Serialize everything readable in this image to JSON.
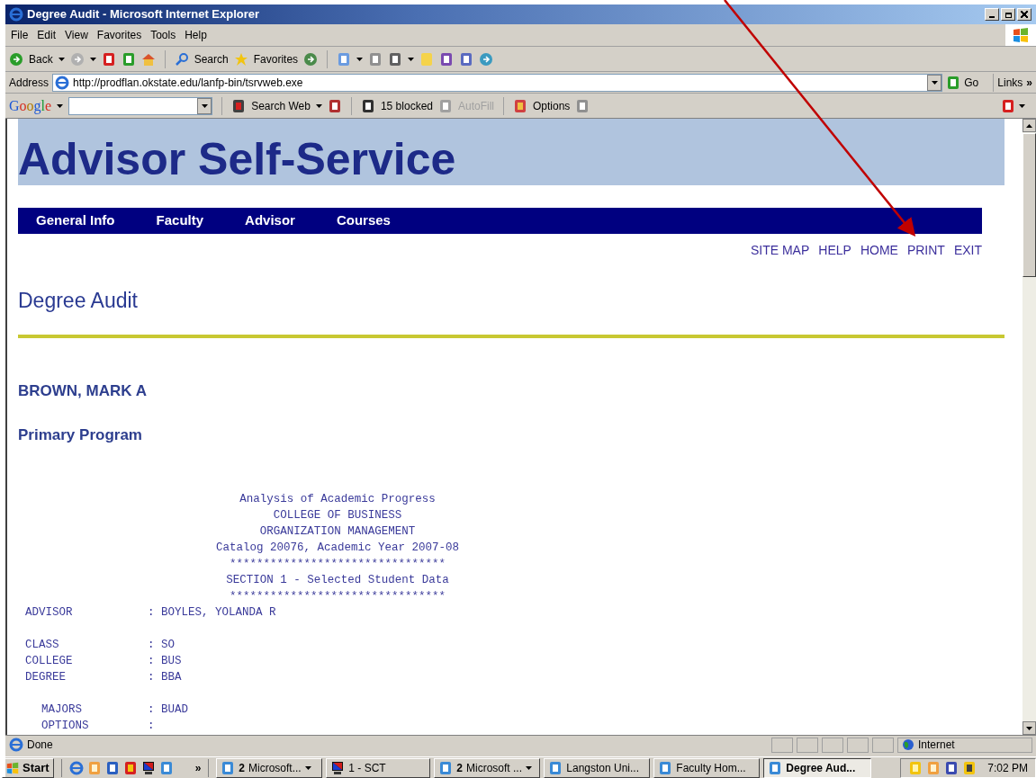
{
  "window": {
    "title": "Degree Audit - Microsoft Internet Explorer"
  },
  "menu": [
    "File",
    "Edit",
    "View",
    "Favorites",
    "Tools",
    "Help"
  ],
  "toolbar": {
    "back": "Back",
    "search": "Search",
    "favorites": "Favorites"
  },
  "address_bar": {
    "label": "Address",
    "value": "http://prodflan.okstate.edu/lanfp-bin/tsrvweb.exe",
    "go": "Go",
    "links": "Links",
    "more": "»"
  },
  "google_bar": {
    "logo": "Google",
    "search_web": "Search Web",
    "blocked": "15 blocked",
    "autofill": {
      "label": "AutoFill",
      "disabled": true
    },
    "options": "Options"
  },
  "page": {
    "banner": "Advisor Self-Service",
    "nav": [
      "General Info",
      "Faculty",
      "Advisor",
      "Courses"
    ],
    "links": [
      "SITE MAP",
      "HELP",
      "HOME",
      "PRINT",
      "EXIT"
    ],
    "heading": "Degree Audit",
    "student": "BROWN, MARK A",
    "program": "Primary Program",
    "report_header": [
      "Analysis of Academic Progress",
      "COLLEGE OF BUSINESS",
      "ORGANIZATION MANAGEMENT",
      "Catalog 20076, Academic Year 2007-08",
      "********************************",
      "SECTION 1 - Selected Student Data",
      "********************************"
    ],
    "field_groups": [
      [
        {
          "label": "ADVISOR",
          "value": ": BOYLES, YOLANDA R",
          "indent": false
        }
      ],
      [
        {
          "label": "CLASS",
          "value": ": SO",
          "indent": false
        },
        {
          "label": "COLLEGE",
          "value": ": BUS",
          "indent": false
        },
        {
          "label": "DEGREE",
          "value": ": BBA",
          "indent": false
        }
      ],
      [
        {
          "label": "MAJORS",
          "value": ": BUAD",
          "indent": true
        },
        {
          "label": "OPTIONS",
          "value": ":",
          "indent": true
        }
      ]
    ]
  },
  "status_bar": {
    "text": "Done",
    "zone": "Internet"
  },
  "taskbar": {
    "start": "Start",
    "more": "»",
    "tasks": [
      {
        "count": "2",
        "label": "Microsoft...",
        "dropdown": true,
        "selected": false
      },
      {
        "label": "1 - SCT",
        "dropdown": false,
        "selected": false
      },
      {
        "count": "2",
        "label": "Microsoft ...",
        "dropdown": true,
        "selected": false
      },
      {
        "label": "Langston Uni...",
        "dropdown": false,
        "selected": false
      },
      {
        "label": "Faculty Hom...",
        "dropdown": false,
        "selected": false
      },
      {
        "label": "Degree Aud...",
        "dropdown": false,
        "selected": true
      }
    ],
    "clock": "7:02 PM"
  }
}
